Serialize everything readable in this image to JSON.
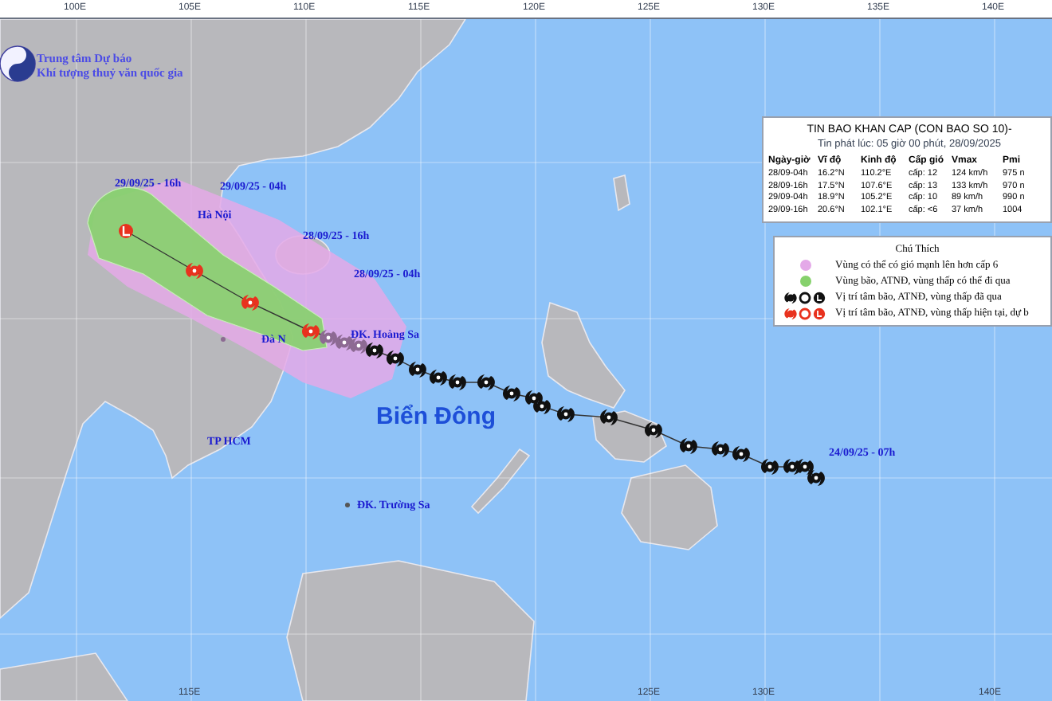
{
  "axis_top": [
    "100E",
    "105E",
    "110E",
    "115E",
    "120E",
    "125E",
    "130E",
    "135E",
    "140E"
  ],
  "axis_bottom": [
    "115E",
    "125E",
    "130E",
    "140E"
  ],
  "agency": {
    "lines": [
      "Trung tâm Dự báo",
      "Khí tượng thuỷ văn quốc gia"
    ]
  },
  "map_labels": [
    {
      "text": "29/09/25 - 16h",
      "kind": "time"
    },
    {
      "text": "29/09/25 - 04h",
      "kind": "time"
    },
    {
      "text": "Hà Nội",
      "kind": "place"
    },
    {
      "text": "28/09/25 - 16h",
      "kind": "time"
    },
    {
      "text": "28/09/25 - 04h",
      "kind": "time"
    },
    {
      "text": "Đà N",
      "kind": "place"
    },
    {
      "text": "ĐK. Hoàng Sa",
      "kind": "place"
    },
    {
      "text": "Biển Đông",
      "kind": "sea"
    },
    {
      "text": "TP HCM",
      "kind": "place"
    },
    {
      "text": "ĐK. Trường Sa",
      "kind": "place"
    },
    {
      "text": "24/09/25 - 07h",
      "kind": "time"
    }
  ],
  "bulletin": {
    "title": "TIN BAO KHAN CAP (CON BAO SO 10)-",
    "issued": "Tin phát lúc: 05 giờ 00 phút, 28/09/2025",
    "columns": [
      "Ngày-giờ",
      "Vĩ độ",
      "Kinh độ",
      "Cấp gió",
      "Vmax",
      "Pmi"
    ],
    "rows": [
      [
        "28/09-04h",
        "16.2°N",
        "110.2°E",
        "cấp: 12",
        "124 km/h",
        "975 n"
      ],
      [
        "28/09-16h",
        "17.5°N",
        "107.6°E",
        "cấp: 13",
        "133 km/h",
        "970 n"
      ],
      [
        "29/09-04h",
        "18.9°N",
        "105.2°E",
        "cấp: 10",
        "89 km/h",
        "990 n"
      ],
      [
        "29/09-16h",
        "20.6°N",
        "102.1°E",
        "cấp: <6",
        "37 km/h",
        "1004"
      ]
    ]
  },
  "legend": {
    "title": "Chú Thích",
    "items": [
      {
        "kind": "swatch",
        "color": "#e4a9e8",
        "text": "Vùng có thể có gió mạnh lên hơn cấp 6"
      },
      {
        "kind": "swatch",
        "color": "#86d16c",
        "text": "Vùng bão, ATNĐ, vùng thấp có thể đi qua"
      },
      {
        "kind": "symbols",
        "color": "#111111",
        "text": "Vị trí tâm bão, ATNĐ, vùng thấp đã qua"
      },
      {
        "kind": "symbols",
        "color": "#e8321e",
        "text": "Vị trí tâm bão, ATNĐ, vùng thấp hiện tại, dự b"
      }
    ]
  }
}
